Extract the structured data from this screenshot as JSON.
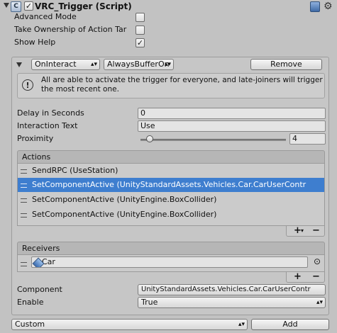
{
  "component": {
    "title": "VRC_Trigger (Script)",
    "enabled": true
  },
  "settings": {
    "advanced_mode_label": "Advanced Mode",
    "advanced_mode": false,
    "take_ownership_label": "Take Ownership of Action Tar",
    "take_ownership": false,
    "show_help_label": "Show Help",
    "show_help": true
  },
  "trigger": {
    "type": "OnInteract",
    "broadcast": "AlwaysBufferOn",
    "remove_label": "Remove",
    "help_text": "All are able to activate the trigger for everyone, and late-joiners will trigger the most recent one.",
    "delay_label": "Delay in Seconds",
    "delay_value": "0",
    "interaction_text_label": "Interaction Text",
    "interaction_text_value": "Use",
    "proximity_label": "Proximity",
    "proximity_value": "4",
    "proximity_slider_fraction": 0.04
  },
  "actions": {
    "header": "Actions",
    "items": [
      {
        "label": "SendRPC (UseStation)",
        "selected": false
      },
      {
        "label": "SetComponentActive (UnityStandardAssets.Vehicles.Car.CarUserContr",
        "selected": true
      },
      {
        "label": "SetComponentActive (UnityEngine.BoxCollider)",
        "selected": false
      },
      {
        "label": "SetComponentActive (UnityEngine.BoxCollider)",
        "selected": false
      }
    ],
    "add_symbol": "+",
    "add_dropdown_symbol": "▾",
    "remove_symbol": "−"
  },
  "receivers": {
    "header": "Receivers",
    "items": [
      {
        "label": "Car",
        "picker": "⊙"
      }
    ],
    "add_symbol": "+",
    "remove_symbol": "−"
  },
  "component_field": {
    "label": "Component",
    "value": "UnityStandardAssets.Vehicles.Car.CarUserContr"
  },
  "enable_field": {
    "label": "Enable",
    "value": "True"
  },
  "bottom_bar": {
    "trigger_type": "Custom",
    "add_label": "Add"
  },
  "colors": {
    "background": "#c2c2c2",
    "selection": "#3e7ecf"
  }
}
